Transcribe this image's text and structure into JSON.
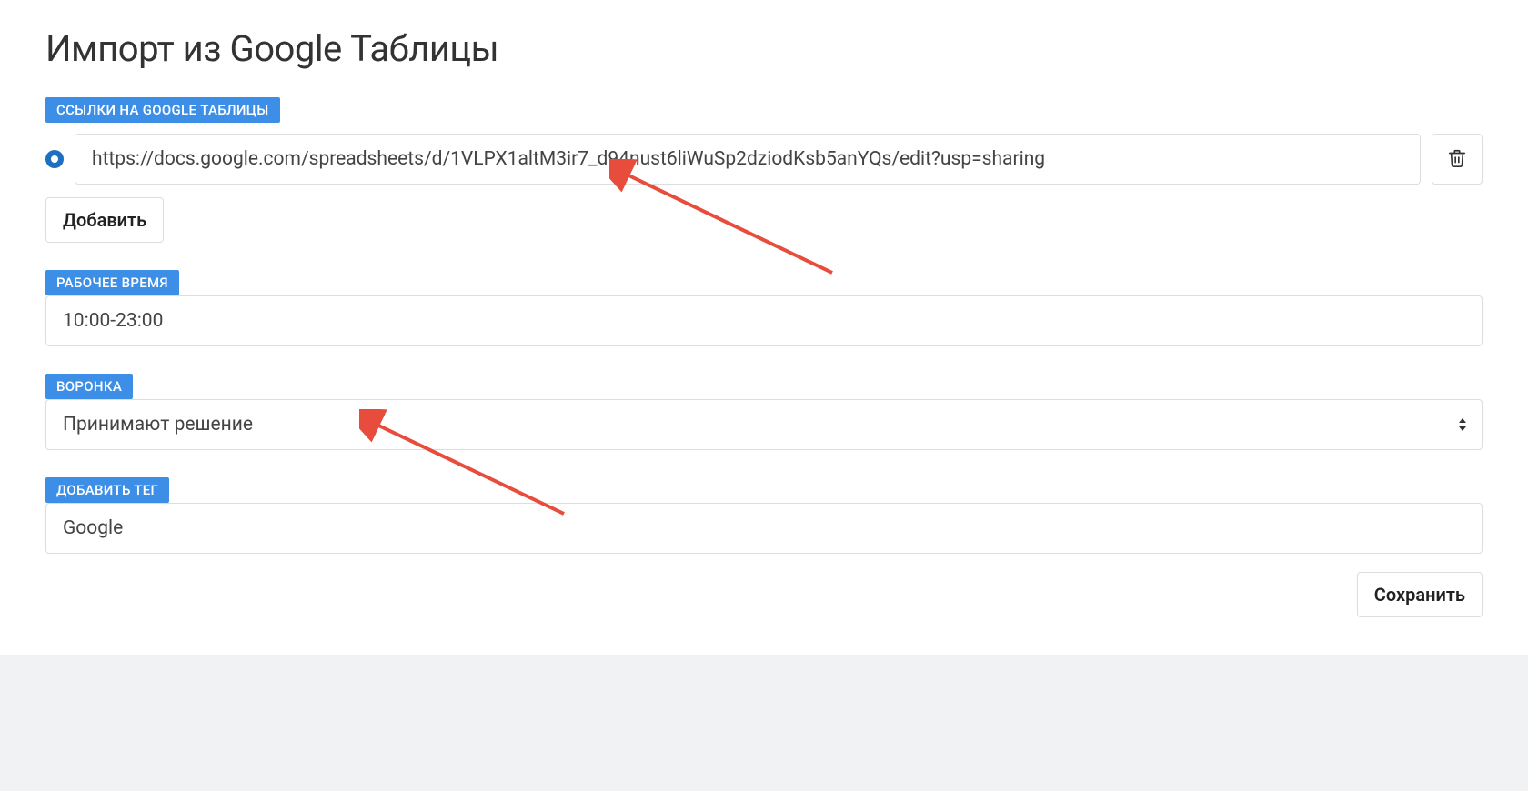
{
  "title": "Импорт из Google Таблицы",
  "sections": {
    "links": {
      "label": "ССЫЛКИ НА GOOGLE ТАБЛИЦЫ",
      "url": "https://docs.google.com/spreadsheets/d/1VLPX1altM3ir7_d94nust6liWuSp2dziodKsb5anYQs/edit?usp=sharing",
      "add_label": "Добавить"
    },
    "work_time": {
      "label": "РАБОЧЕЕ ВРЕМЯ",
      "value": "10:00-23:00"
    },
    "funnel": {
      "label": "ВОРОНКА",
      "selected": "Принимают решение"
    },
    "tag": {
      "label": "ДОБАВИТЬ ТЕГ",
      "value": "Google"
    }
  },
  "save_label": "Сохранить"
}
